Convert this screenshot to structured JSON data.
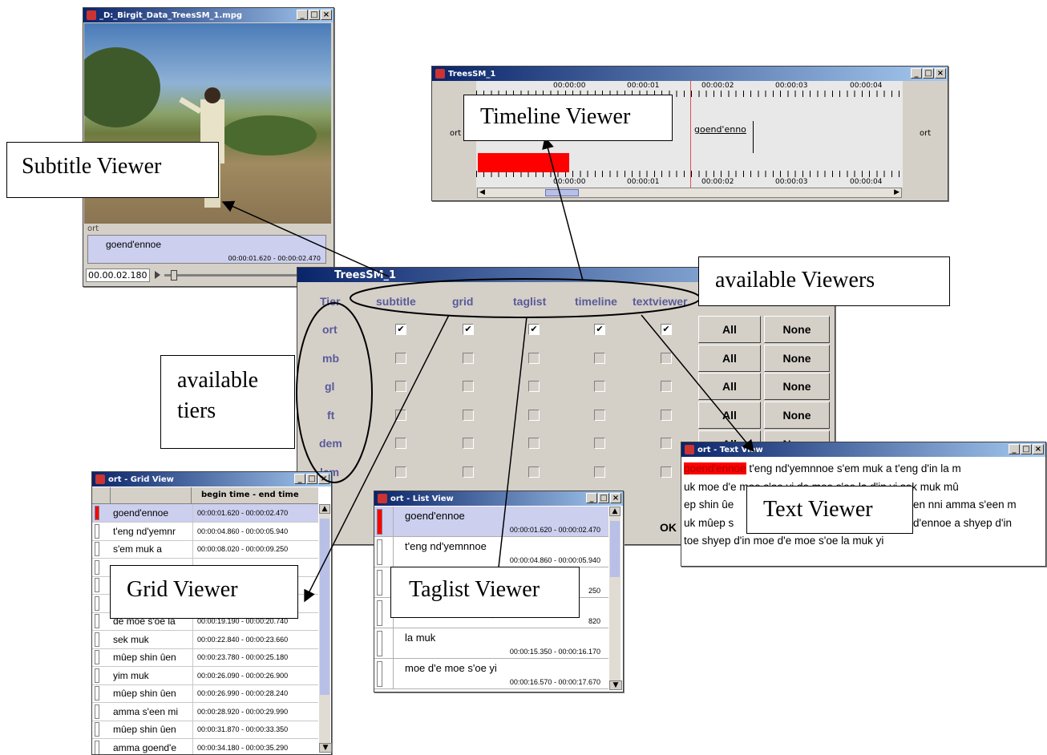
{
  "video": {
    "title": "_D:_Birgit_Data_TreesSM_1.mpg",
    "tier": "ort",
    "subtitle": "goend'ennoe",
    "times": "00:00:01.620  -  00:00:02.470",
    "timecode": "00.00.02.180"
  },
  "timeline": {
    "title": "TreesSM_1",
    "ticks": [
      "00:00:00",
      "00:00:01",
      "00:00:02",
      "00:00:03",
      "00:00:04"
    ],
    "tier_left": "ort",
    "tier_right": "ort",
    "annotation": "goend'enno"
  },
  "selector": {
    "title": "TreesSM_1",
    "tier_header": "Tier",
    "columns": [
      "subtitle",
      "grid",
      "taglist",
      "timeline",
      "textviewer"
    ],
    "tiers": [
      "ort",
      "mb",
      "gl",
      "ft",
      "dem",
      "lem"
    ],
    "all_label": "All",
    "none_label": "None",
    "ok_label": "OK"
  },
  "grid": {
    "title": "ort - Grid View",
    "header": "begin time  -  end time",
    "rows": [
      {
        "text": "goend'ennoe",
        "time": "00:00:01.620  -  00:00:02.470"
      },
      {
        "text": "t'eng nd'yemnr",
        "time": "00:00:04.860  -  00:00:05.940"
      },
      {
        "text": "s'em muk a",
        "time": "00:00:08.020  -  00:00:09.250"
      },
      {
        "text": "",
        "time": ""
      },
      {
        "text": "",
        "time": ""
      },
      {
        "text": "",
        "time": ""
      },
      {
        "text": "de moe s'oe la",
        "time": "00:00:19.190  -  00:00:20.740"
      },
      {
        "text": "sek muk",
        "time": "00:00:22.840  -  00:00:23.660"
      },
      {
        "text": "mûep shin ûen",
        "time": "00:00:23.780  -  00:00:25.180"
      },
      {
        "text": "yim muk",
        "time": "00:00:26.090  -  00:00:26.900"
      },
      {
        "text": "mûep shin ûen",
        "time": "00:00:26.990  -  00:00:28.240"
      },
      {
        "text": "amma s'een mi",
        "time": "00:00:28.920  -  00:00:29.990"
      },
      {
        "text": "mûep shin ûen",
        "time": "00:00:31.870  -  00:00:33.350"
      },
      {
        "text": "amma goend'e",
        "time": "00:00:34.180  -  00:00:35.290"
      }
    ]
  },
  "taglist": {
    "title": "ort - List View",
    "items": [
      {
        "text": "goend'ennoe",
        "time": "00:00:01.620  -  00:00:02.470"
      },
      {
        "text": "t'eng nd'yemnnoe",
        "time": "00:00:04.860  -  00:00:05.940"
      },
      {
        "text": "",
        "time": "250"
      },
      {
        "text": "",
        "time": "820"
      },
      {
        "text": "la muk",
        "time": "00:00:15.350  -  00:00:16.170"
      },
      {
        "text": "moe d'e moe s'oe yi",
        "time": "00:00:16.570  -  00:00:17.670"
      }
    ]
  },
  "textview": {
    "title": "ort - Text View",
    "highlight": "goend'ennoe",
    "lines": [
      " t'eng nd'yemnnoe s'em muk a t'eng d'in la m",
      "uk moe d'e moe s'oe yi de moe s'oe la d'in yi sek muk mû",
      "ep shin ûe",
      "uk mûep s",
      " toe shyep d'in moe d'e moe s'oe la muk yi"
    ],
    "line3_tail": "en nni amma s'een m",
    "line4_tail": "d'ennoe a shyep d'in"
  },
  "callouts": {
    "subtitle": "Subtitle Viewer",
    "timeline": "Timeline Viewer",
    "viewers": "available Viewers",
    "tiers_line1": "available",
    "tiers_line2": "tiers",
    "grid": "Grid Viewer",
    "taglist": "Taglist Viewer",
    "text": "Text Viewer"
  }
}
